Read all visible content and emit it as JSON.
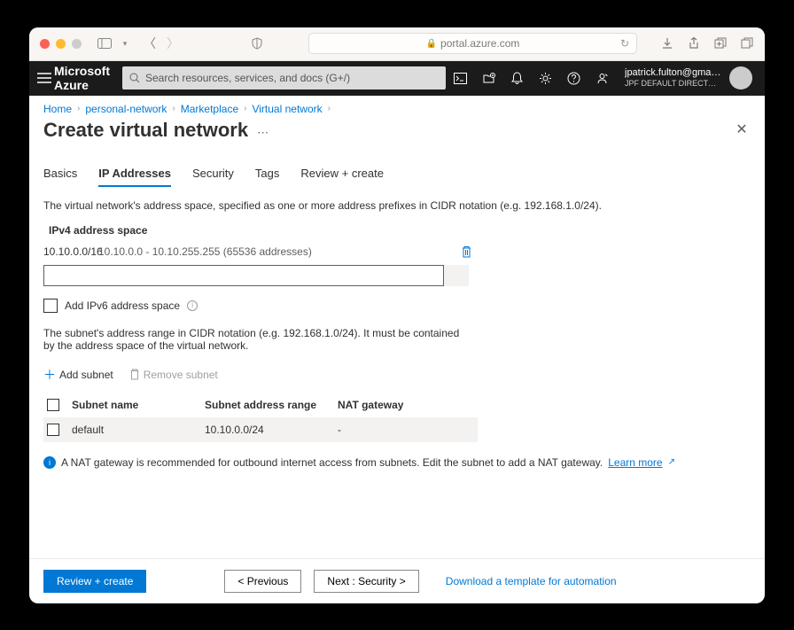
{
  "browser": {
    "url_host": "portal.azure.com"
  },
  "azure": {
    "logo": "Microsoft Azure",
    "search_placeholder": "Search resources, services, and docs (G+/)",
    "user_email": "jpatrick.fulton@gmail.c...",
    "user_directory": "JPF DEFAULT DIRECTORY (JPATR..."
  },
  "breadcrumb": {
    "items": [
      "Home",
      "personal-network",
      "Marketplace",
      "Virtual network"
    ]
  },
  "page": {
    "title": "Create virtual network"
  },
  "tabs": [
    "Basics",
    "IP Addresses",
    "Security",
    "Tags",
    "Review + create"
  ],
  "desc": "The virtual network's address space, specified as one or more address prefixes in CIDR notation (e.g. 192.168.1.0/24).",
  "ipv4": {
    "section_label": "IPv4 address space",
    "rows": [
      {
        "cidr": "10.10.0.0/16",
        "range": "10.10.0.0 - 10.10.255.255 (65536 addresses)"
      }
    ],
    "input_value": ""
  },
  "ipv6": {
    "checkbox_label": "Add IPv6 address space"
  },
  "subnet": {
    "desc": "The subnet's address range in CIDR notation (e.g. 192.168.1.0/24). It must be contained by the address space of the virtual network.",
    "add_label": "Add subnet",
    "remove_label": "Remove subnet",
    "headers": {
      "name": "Subnet name",
      "range": "Subnet address range",
      "nat": "NAT gateway"
    },
    "rows": [
      {
        "name": "default",
        "range": "10.10.0.0/24",
        "nat": "-"
      }
    ],
    "nat_info": "A NAT gateway is recommended for outbound internet access from subnets. Edit the subnet to add a NAT gateway.",
    "learn_more": "Learn more"
  },
  "footer": {
    "review": "Review + create",
    "previous": "< Previous",
    "next": "Next : Security >",
    "download_link": "Download a template for automation"
  }
}
